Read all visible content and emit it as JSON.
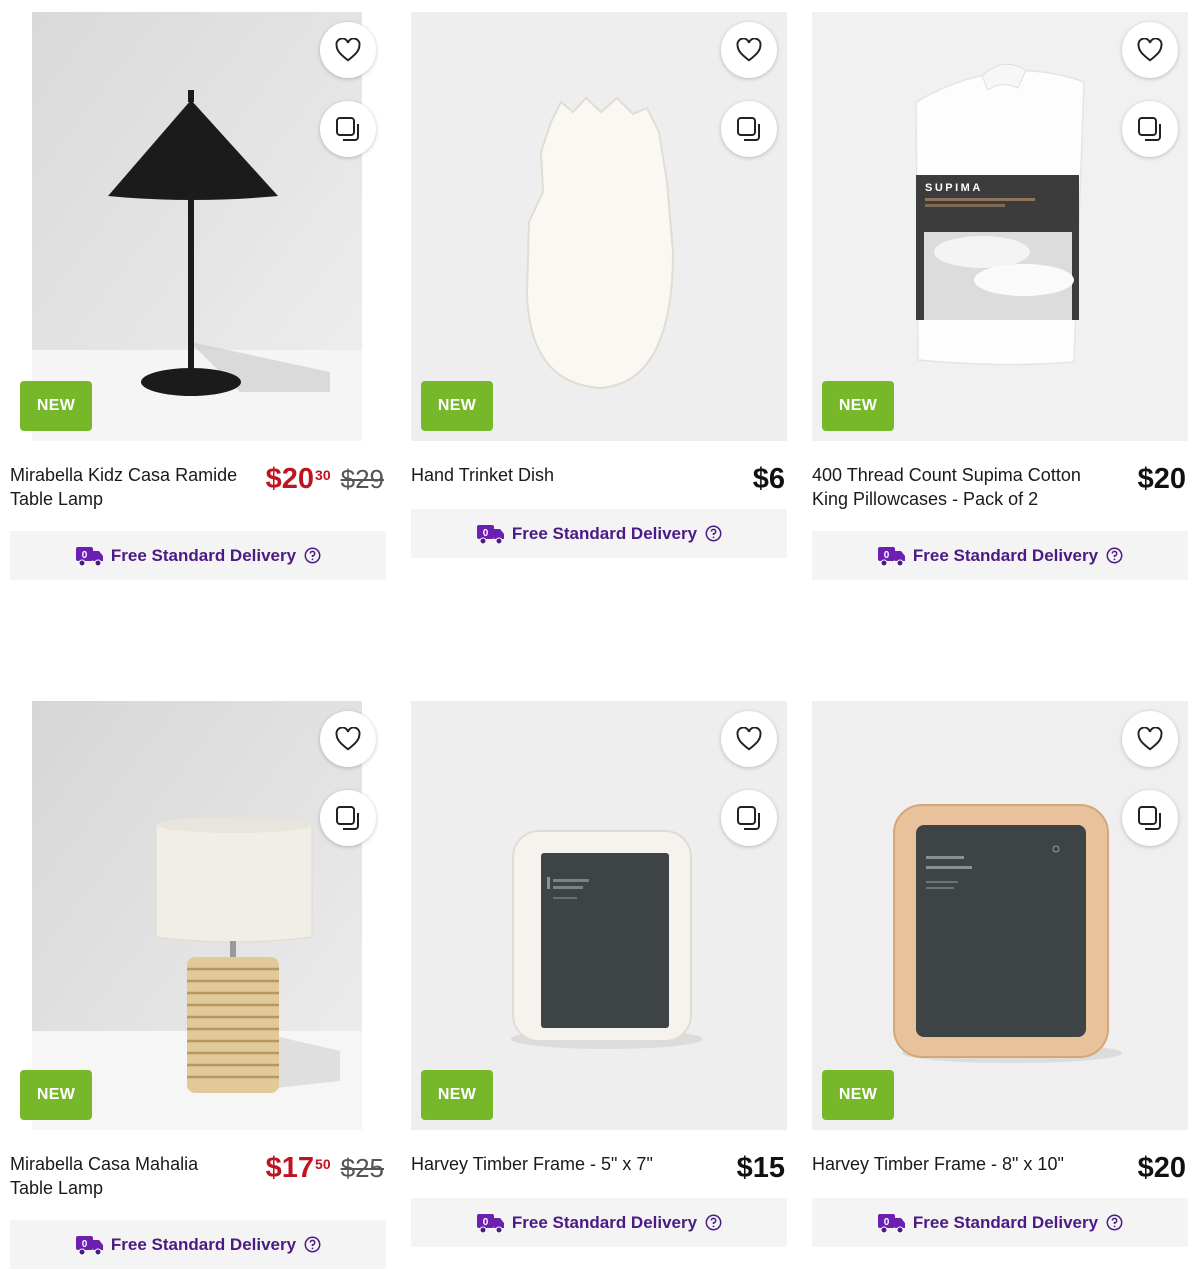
{
  "products": [
    {
      "name": "Mirabella Kidz Casa Ramide Table Lamp",
      "badge": "NEW",
      "price_main": "$20",
      "price_cents": "30",
      "was_price": "$29",
      "delivery": "Free Standard Delivery",
      "on_sale": true
    },
    {
      "name": "Hand Trinket Dish",
      "badge": "NEW",
      "price_main": "$6",
      "price_cents": "",
      "was_price": "",
      "delivery": "Free Standard Delivery",
      "on_sale": false
    },
    {
      "name": "400 Thread Count Supima Cotton King Pillowcases - Pack of 2",
      "badge": "NEW",
      "price_main": "$20",
      "price_cents": "",
      "was_price": "",
      "delivery": "Free Standard Delivery",
      "on_sale": false,
      "package_brand": "SUPIMA"
    },
    {
      "name": "Mirabella Casa Mahalia Table Lamp",
      "badge": "NEW",
      "price_main": "$17",
      "price_cents": "50",
      "was_price": "$25",
      "delivery": "Free Standard Delivery",
      "on_sale": true
    },
    {
      "name": "Harvey Timber Frame - 5\" x 7\"",
      "badge": "NEW",
      "price_main": "$15",
      "price_cents": "",
      "was_price": "",
      "delivery": "Free Standard Delivery",
      "on_sale": false
    },
    {
      "name": "Harvey Timber Frame - 8\" x 10\"",
      "badge": "NEW",
      "price_main": "$20",
      "price_cents": "",
      "was_price": "",
      "delivery": "Free Standard Delivery",
      "on_sale": false
    }
  ],
  "icons": {
    "favourite": "heart-icon",
    "compare": "compare-icon",
    "delivery": "truck-icon",
    "help": "help-circle-icon"
  },
  "colors": {
    "badge": "#76b82a",
    "sale_price": "#c0121f",
    "delivery_text": "#4b1a85",
    "delivery_bg": "#f4f4f4"
  }
}
